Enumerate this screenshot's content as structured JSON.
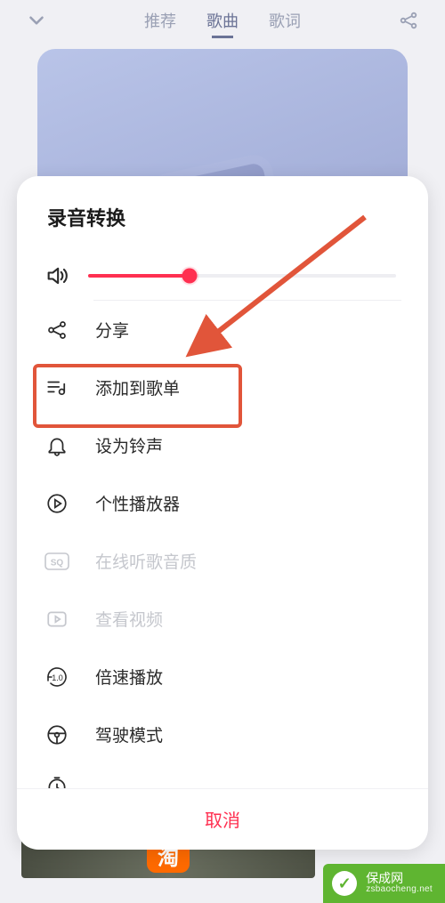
{
  "header": {
    "tabs": [
      "推荐",
      "歌曲",
      "歌词"
    ],
    "active_tab_index": 1
  },
  "sheet": {
    "title": "录音转换",
    "volume_percent": 33,
    "items": [
      {
        "icon": "share-icon",
        "label": "分享",
        "disabled": false,
        "highlighted": false
      },
      {
        "icon": "add-playlist-icon",
        "label": "添加到歌单",
        "disabled": false,
        "highlighted": true
      },
      {
        "icon": "bell-icon",
        "label": "设为铃声",
        "disabled": false,
        "highlighted": false
      },
      {
        "icon": "player-skin-icon",
        "label": "个性播放器",
        "disabled": false,
        "highlighted": false
      },
      {
        "icon": "sq-quality-icon",
        "label": "在线听歌音质",
        "disabled": true,
        "highlighted": false
      },
      {
        "icon": "video-icon",
        "label": "查看视频",
        "disabled": true,
        "highlighted": false
      },
      {
        "icon": "speed-icon",
        "label": "倍速播放",
        "disabled": false,
        "highlighted": false
      },
      {
        "icon": "steering-icon",
        "label": "驾驶模式",
        "disabled": false,
        "highlighted": false
      }
    ],
    "cancel_label": "取消"
  },
  "annotation": {
    "arrow_color": "#e1553a"
  },
  "watermark": {
    "title": "保成网",
    "sub": "zsbaocheng.net"
  },
  "bottom_strip": {
    "badge": "淘"
  }
}
